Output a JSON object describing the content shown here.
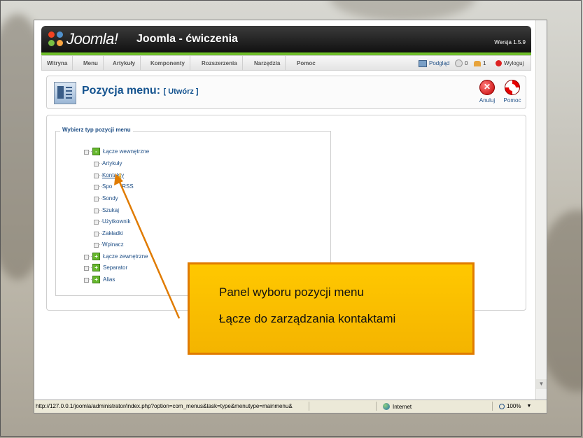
{
  "header": {
    "logo_text": "Joomla!",
    "site_title": "Joomla - ćwiczenia",
    "version": "Wersja 1.5.9"
  },
  "menu": {
    "items": [
      "Witryna",
      "Menu",
      "Artykuły",
      "Komponenty",
      "Rozszerzenia",
      "Narzędzia",
      "Pomoc"
    ],
    "preview": "Podgląd",
    "messages_count": "0",
    "users_count": "1",
    "logout": "Wyloguj"
  },
  "toolbar": {
    "title": "Pozycja menu:",
    "subtitle": "[ Utwórz ]",
    "cancel": "Anuluj",
    "help": "Pomoc"
  },
  "panel": {
    "legend": "Wybierz typ pozycji menu",
    "internal_links": "Łącze wewnętrzne",
    "children": [
      "Artykuły",
      "Kontakty",
      "Spo",
      "RSS",
      "Sondy",
      "Szukaj",
      "Użytkownik",
      "Zakładki",
      "Wpinacz"
    ],
    "external_link": "Łącze zewnętrzne",
    "separator": "Separator",
    "alias": "Alias",
    "expand_symbol": "+",
    "collapse_symbol": "-"
  },
  "statusbar": {
    "url": "http://127.0.0.1/joomla/administrator/index.php?option=com_menus&task=type&menutype=mainmenu&",
    "zone": "Internet",
    "zoom": "100%"
  },
  "callout": {
    "line1": "Panel wyboru pozycji menu",
    "line2": "Łącze do zarządzania kontaktami"
  },
  "colors": {
    "accent_green": "#6fbf2a",
    "link_blue": "#1f4f86",
    "callout_fill": "#ffc800",
    "callout_border": "#e07b00",
    "arrow": "#e07b00"
  }
}
